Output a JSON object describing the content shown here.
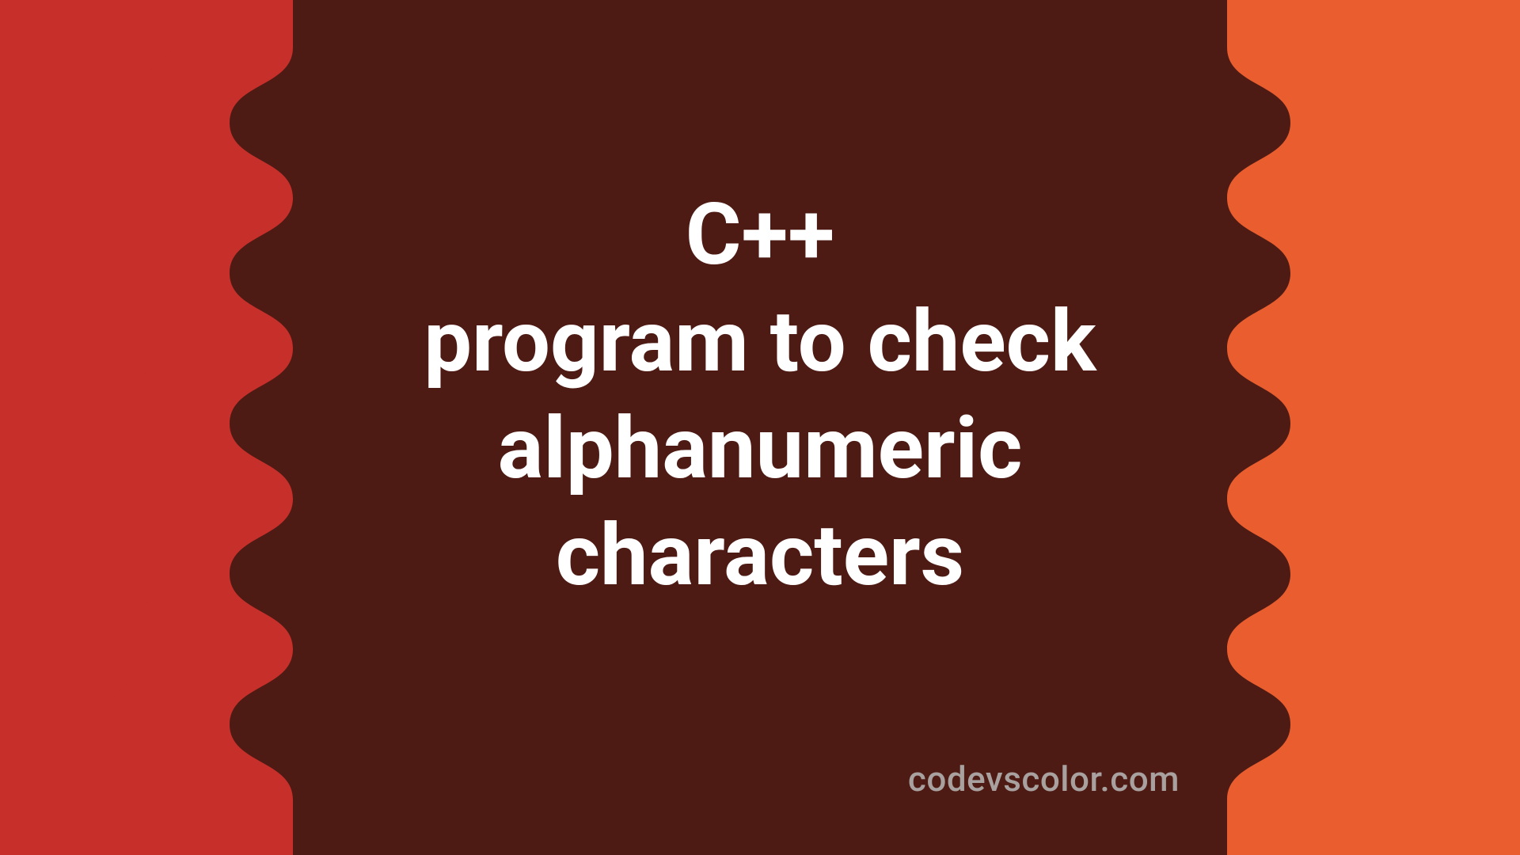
{
  "title_lines": [
    "C++",
    "program to check",
    "alphanumeric",
    "characters"
  ],
  "credit": "codevscolor.com",
  "colors": {
    "bg": "#4e1b14",
    "left": "#c62f2a",
    "right": "#e95d2e",
    "text": "#ffffff",
    "credit": "#a8a19f"
  }
}
